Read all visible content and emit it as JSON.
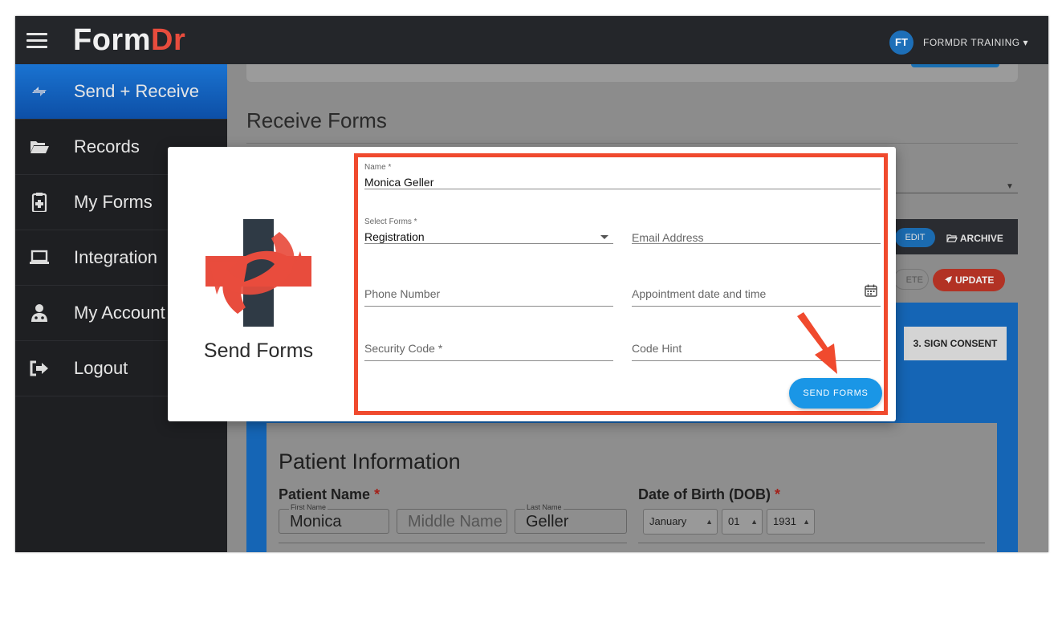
{
  "app": {
    "logo_part1": "Form",
    "logo_part2": "Dr",
    "user_initials": "FT",
    "user_name": "FORMDR TRAINING ▾"
  },
  "sidebar": {
    "items": [
      {
        "label": "Send + Receive",
        "icon": "send-receive-icon",
        "active": true
      },
      {
        "label": "Records",
        "icon": "folder-open-icon"
      },
      {
        "label": "My Forms",
        "icon": "clipboard-plus-icon"
      },
      {
        "label": "Integration",
        "icon": "laptop-icon"
      },
      {
        "label": "My Account",
        "icon": "user-doctor-icon"
      },
      {
        "label": "Logout",
        "icon": "sign-out-icon"
      }
    ]
  },
  "main": {
    "receive_title": "Receive Forms",
    "edit_label": "EDIT",
    "archive_label": "ARCHIVE",
    "delete_label": "ETE",
    "update_label": "UPDATE",
    "consent_tab": "3. SIGN CONSENT",
    "patient": {
      "title": "Patient Information",
      "name_label": "Patient Name",
      "required_mark": "*",
      "first_name_label": "First Name",
      "first_name": "Monica",
      "middle_name_placeholder": "Middle Name",
      "last_name_label": "Last Name",
      "last_name": "Geller",
      "dob_label": "Date of Birth (DOB)",
      "dob_month": "January",
      "dob_day": "01",
      "dob_year": "1931"
    }
  },
  "modal": {
    "title": "Send Forms",
    "name_label": "Name *",
    "name_value": "Monica Geller",
    "select_forms_label": "Select Forms *",
    "select_forms_value": "Registration",
    "email_placeholder": "Email Address",
    "phone_placeholder": "Phone Number",
    "appointment_placeholder": "Appointment date and time",
    "security_code_placeholder": "Security Code *",
    "code_hint_placeholder": "Code Hint",
    "send_button": "SEND FORMS"
  },
  "colors": {
    "topbar": "#24262a",
    "sidebar": "#1e1f22",
    "active_nav": "#0d4fa6",
    "brand_red": "#e84c3d",
    "highlight_frame": "#f04a2e",
    "send_button": "#1a96e6"
  }
}
